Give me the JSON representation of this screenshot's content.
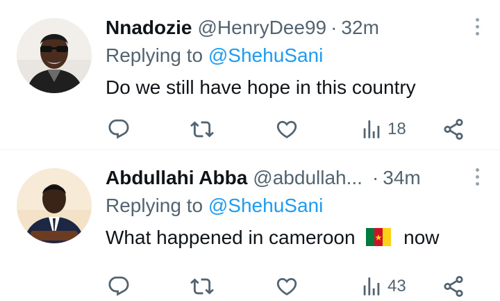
{
  "tweets": [
    {
      "name": "Nnadozie",
      "handle": "@HenryDee99",
      "separator": "·",
      "time": "32m",
      "replying_prefix": "Replying to",
      "replying_to": "@ShehuSani",
      "text": "Do we still have hope in this country",
      "flag": false,
      "text_suffix": "",
      "views": "18"
    },
    {
      "name": "Abdullahi Abba",
      "handle": "@abdullah...",
      "separator": "·",
      "time": "34m",
      "replying_prefix": "Replying to",
      "replying_to": "@ShehuSani",
      "text": "What happened in cameroon",
      "flag": true,
      "text_suffix": "now",
      "views": "43"
    }
  ],
  "icons": {
    "reply": "reply-icon",
    "retweet": "retweet-icon",
    "like": "heart-icon",
    "views": "views-icon",
    "share": "share-icon",
    "more": "more-icon"
  },
  "colors": {
    "text": "#0f1419",
    "secondary": "#536471",
    "mention": "#1d9bf0",
    "divider": "#eff3f4"
  }
}
